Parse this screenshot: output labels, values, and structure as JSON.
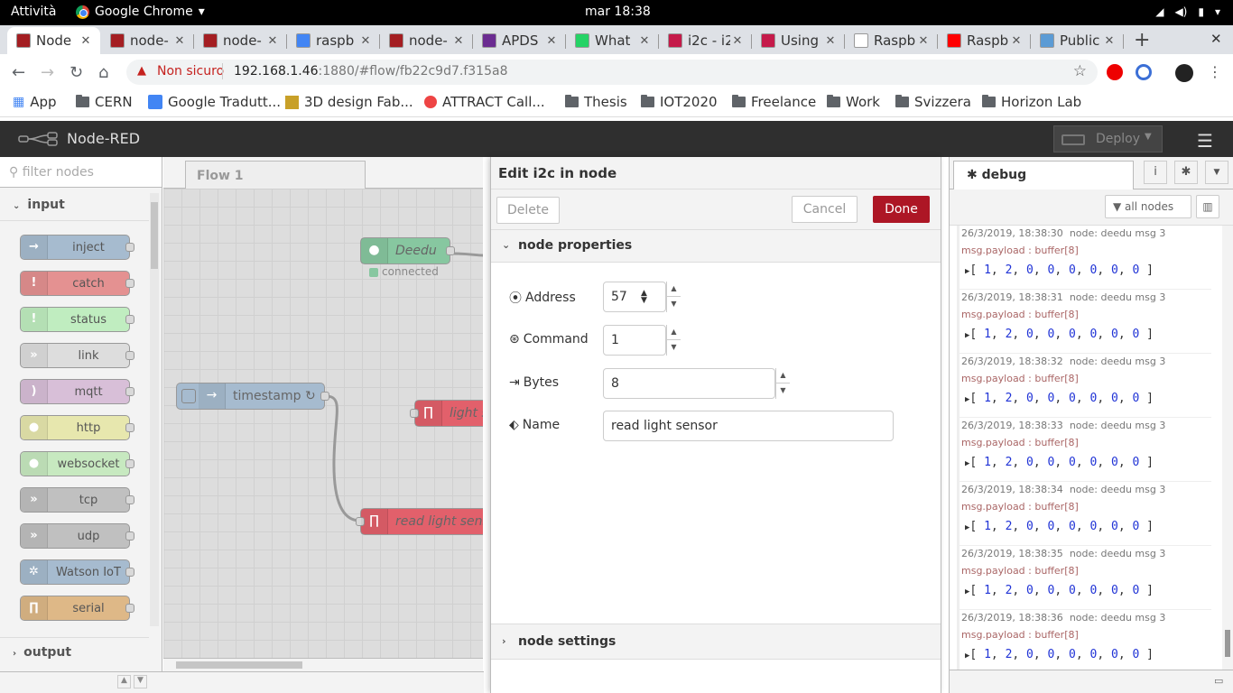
{
  "os": {
    "activities": "Attività",
    "app_name": "Google Chrome",
    "clock": "mar 18:38"
  },
  "tabs": [
    {
      "title": "Node"
    },
    {
      "title": "node-"
    },
    {
      "title": "node-"
    },
    {
      "title": "raspb"
    },
    {
      "title": "node-"
    },
    {
      "title": "APDS"
    },
    {
      "title": "What"
    },
    {
      "title": "i2c - i2"
    },
    {
      "title": "Using"
    },
    {
      "title": "Raspb"
    },
    {
      "title": "Raspb"
    },
    {
      "title": "Public"
    }
  ],
  "address": {
    "security_label": "Non sicuro",
    "host": "192.168.1.46",
    "rest": ":1880/#flow/fb22c9d7.f315a8"
  },
  "bookmarks": [
    "App",
    "CERN",
    "Google Tradutt...",
    "3D design Fab...",
    "ATTRACT Call...",
    "Thesis",
    "IOT2020",
    "Freelance",
    "Work",
    "Svizzera",
    "Horizon Lab"
  ],
  "nodered": {
    "title": "Node-RED",
    "deploy_label": "Deploy"
  },
  "palette": {
    "filter_placeholder": "filter nodes",
    "category_input": "input",
    "category_output": "output",
    "nodes": [
      {
        "label": "inject",
        "color": "#a6bbcf",
        "icon": "→"
      },
      {
        "label": "catch",
        "color": "#e49191",
        "icon": "!"
      },
      {
        "label": "status",
        "color": "#c0edc0",
        "icon": "!"
      },
      {
        "label": "link",
        "color": "#dddddd",
        "icon": "»"
      },
      {
        "label": "mqtt",
        "color": "#d8bfd8",
        "icon": ")"
      },
      {
        "label": "http",
        "color": "#e7e7ae",
        "icon": "●"
      },
      {
        "label": "websocket",
        "color": "#c7e9c0",
        "icon": "●"
      },
      {
        "label": "tcp",
        "color": "#c0c0c0",
        "icon": "»"
      },
      {
        "label": "udp",
        "color": "#c0c0c0",
        "icon": "»"
      },
      {
        "label": "Watson IoT",
        "color": "#a6bbcf",
        "icon": "✲"
      },
      {
        "label": "serial",
        "color": "#deb887",
        "icon": "∏"
      }
    ]
  },
  "workspace": {
    "flow_tab": "Flow 1",
    "nodes": [
      {
        "label": "Deedu",
        "status": "connected"
      },
      {
        "label": "timestamp ↻"
      },
      {
        "label": "light s"
      },
      {
        "label": "read light sensor"
      }
    ]
  },
  "editor": {
    "title": "Edit i2c in node",
    "delete_label": "Delete",
    "cancel_label": "Cancel",
    "done_label": "Done",
    "section_properties": "node properties",
    "section_settings": "node settings",
    "fields": {
      "address_label": "Address",
      "address_value": "57",
      "command_label": "Command",
      "command_value": "1",
      "bytes_label": "Bytes",
      "bytes_value": "8",
      "name_label": "Name",
      "name_value": "read light sensor"
    }
  },
  "sidebar": {
    "tab_label": "debug",
    "filter_label": "all nodes",
    "messages": [
      {
        "time": "26/3/2019, 18:38:30",
        "node": "node: deedu msg 3",
        "topic": "msg.payload : buffer[8]",
        "values": [
          "1",
          "2",
          "0",
          "0",
          "0",
          "0",
          "0",
          "0"
        ]
      },
      {
        "time": "26/3/2019, 18:38:31",
        "node": "node: deedu msg 3",
        "topic": "msg.payload : buffer[8]",
        "values": [
          "1",
          "2",
          "0",
          "0",
          "0",
          "0",
          "0",
          "0"
        ]
      },
      {
        "time": "26/3/2019, 18:38:32",
        "node": "node: deedu msg 3",
        "topic": "msg.payload : buffer[8]",
        "values": [
          "1",
          "2",
          "0",
          "0",
          "0",
          "0",
          "0",
          "0"
        ]
      },
      {
        "time": "26/3/2019, 18:38:33",
        "node": "node: deedu msg 3",
        "topic": "msg.payload : buffer[8]",
        "values": [
          "1",
          "2",
          "0",
          "0",
          "0",
          "0",
          "0",
          "0"
        ]
      },
      {
        "time": "26/3/2019, 18:38:34",
        "node": "node: deedu msg 3",
        "topic": "msg.payload : buffer[8]",
        "values": [
          "1",
          "2",
          "0",
          "0",
          "0",
          "0",
          "0",
          "0"
        ]
      },
      {
        "time": "26/3/2019, 18:38:35",
        "node": "node: deedu msg 3",
        "topic": "msg.payload : buffer[8]",
        "values": [
          "1",
          "2",
          "0",
          "0",
          "0",
          "0",
          "0",
          "0"
        ]
      },
      {
        "time": "26/3/2019, 18:38:36",
        "node": "node: deedu msg 3",
        "topic": "msg.payload : buffer[8]",
        "values": [
          "1",
          "2",
          "0",
          "0",
          "0",
          "0",
          "0",
          "0"
        ]
      }
    ]
  }
}
